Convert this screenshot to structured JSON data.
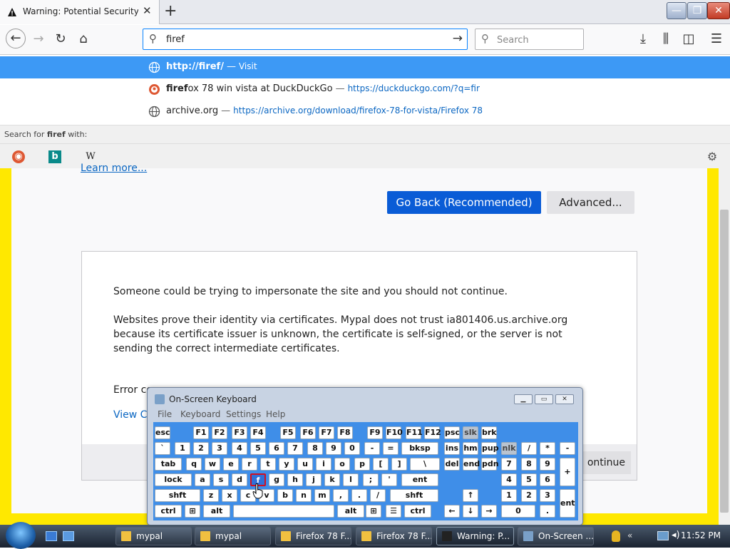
{
  "tab": {
    "title": "Warning: Potential Security Risk Ahead",
    "close": "✕"
  },
  "newtab": "+",
  "window": {
    "min": "—",
    "max": "❐",
    "close": "✕"
  },
  "nav": {
    "url_value": "firef",
    "search_placeholder": "Search"
  },
  "dropdown": {
    "rows": [
      {
        "bold": "http://firef/",
        "rest": "",
        "sep": "—",
        "action": "Visit"
      },
      {
        "bold": "firef",
        "rest": "ox 78 win vista at DuckDuckGo",
        "sep": "—",
        "url": "https://duckduckgo.com/?q=fir"
      },
      {
        "bold": "",
        "rest": "archive.org",
        "sep": "—",
        "url": "https://archive.org/download/firefox-78-for-vista/Firefox 78"
      }
    ],
    "search_for_prefix": "Search for ",
    "search_for_term": "firef",
    "search_for_suffix": " with:",
    "engines": [
      "DuckDuckGo",
      "Bing",
      "W"
    ]
  },
  "page": {
    "learn_more": "Learn more...",
    "go_back": "Go Back (Recommended)",
    "advanced": "Advanced...",
    "p1": "Someone could be trying to impersonate the site and you should not continue.",
    "p2": "Websites prove their identity via certificates. Mypal does not trust ia801406.us.archive.org because its certificate issuer is unknown, the certificate is self-signed, or the server is not sending the correct intermediate certificates.",
    "error_code": "Error co",
    "view_cert": "View Ce",
    "continue": "ontinue"
  },
  "osk": {
    "title": "On-Screen Keyboard",
    "menu": [
      "File",
      "Keyboard",
      "Settings",
      "Help"
    ],
    "rows": [
      [
        "esc",
        "F1",
        "F2",
        "F3",
        "F4",
        "F5",
        "F6",
        "F7",
        "F8",
        "F9",
        "F10",
        "F11",
        "F12",
        "psc",
        "slk",
        "brk"
      ],
      [
        "`",
        "1",
        "2",
        "3",
        "4",
        "5",
        "6",
        "7",
        "8",
        "9",
        "0",
        "-",
        "=",
        "bksp",
        "ins",
        "hm",
        "pup",
        "nlk",
        "/",
        "*",
        "-"
      ],
      [
        "tab",
        "q",
        "w",
        "e",
        "r",
        "t",
        "y",
        "u",
        "i",
        "o",
        "p",
        "[",
        "]",
        "\\",
        "del",
        "end",
        "pdn",
        "7",
        "8",
        "9",
        "+"
      ],
      [
        "lock",
        "a",
        "s",
        "d",
        "f",
        "g",
        "h",
        "j",
        "k",
        "l",
        ";",
        "'",
        "ent",
        "4",
        "5",
        "6"
      ],
      [
        "shft",
        "z",
        "x",
        "c",
        "v",
        "b",
        "n",
        "m",
        ",",
        ".",
        "/",
        "shft",
        "↑",
        "1",
        "2",
        "3",
        "ent"
      ],
      [
        "ctrl",
        "⊞",
        "alt",
        "",
        "alt",
        "⊞",
        "☰",
        "ctrl",
        "←",
        "↓",
        "→",
        "0",
        "."
      ]
    ]
  },
  "taskbar": {
    "items": [
      "mypal",
      "mypal",
      "Firefox 78 F...",
      "Firefox 78 F...",
      "Warning: P...",
      "On-Screen ..."
    ],
    "clock": "11:52 PM"
  }
}
